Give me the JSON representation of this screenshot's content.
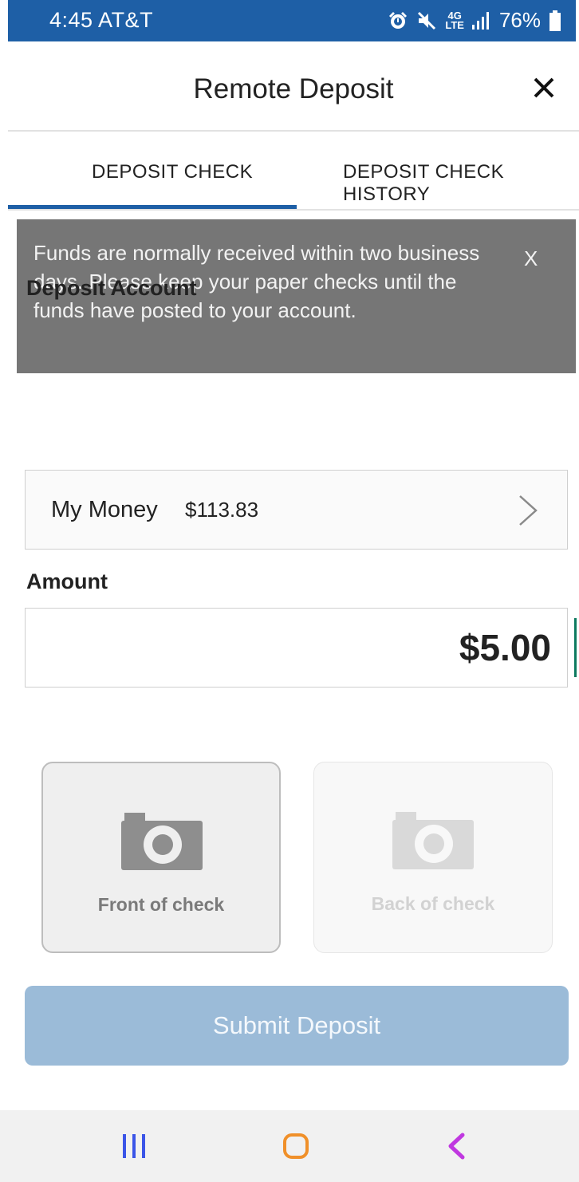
{
  "status_bar": {
    "time": "4:45 AT&T",
    "network_top": "4G",
    "network_bottom": "LTE",
    "battery": "76%",
    "icons": [
      "alarm-icon",
      "mute-icon",
      "signal-icon",
      "battery-icon"
    ]
  },
  "header": {
    "title": "Remote Deposit",
    "close_icon": "close-icon"
  },
  "tabs": [
    {
      "label": "DEPOSIT CHECK",
      "active": true
    },
    {
      "label": "DEPOSIT CHECK HISTORY",
      "active": false
    }
  ],
  "banner": {
    "message": "Funds are normally received within two business days. Please keep your paper checks until the funds have posted to your account.",
    "close_label": "X"
  },
  "deposit_account": {
    "label": "Deposit Account",
    "name": "My Money",
    "balance": "$113.83"
  },
  "amount": {
    "label": "Amount",
    "value": "$5.00"
  },
  "capture": {
    "front_label": "Front of check",
    "back_label": "Back of check",
    "icon": "camera-icon"
  },
  "submit": {
    "label": "Submit Deposit"
  },
  "navbar": {
    "items": [
      "recent-apps-icon",
      "home-icon",
      "back-icon"
    ]
  },
  "colors": {
    "brand_blue": "#1e5fa6",
    "banner_gray": "#767676",
    "submit_disabled": "#9bbbd8",
    "caret": "#0d7a5f",
    "nav_recent": "#3b55e8",
    "nav_home": "#f0902a",
    "nav_back": "#c038e0"
  }
}
